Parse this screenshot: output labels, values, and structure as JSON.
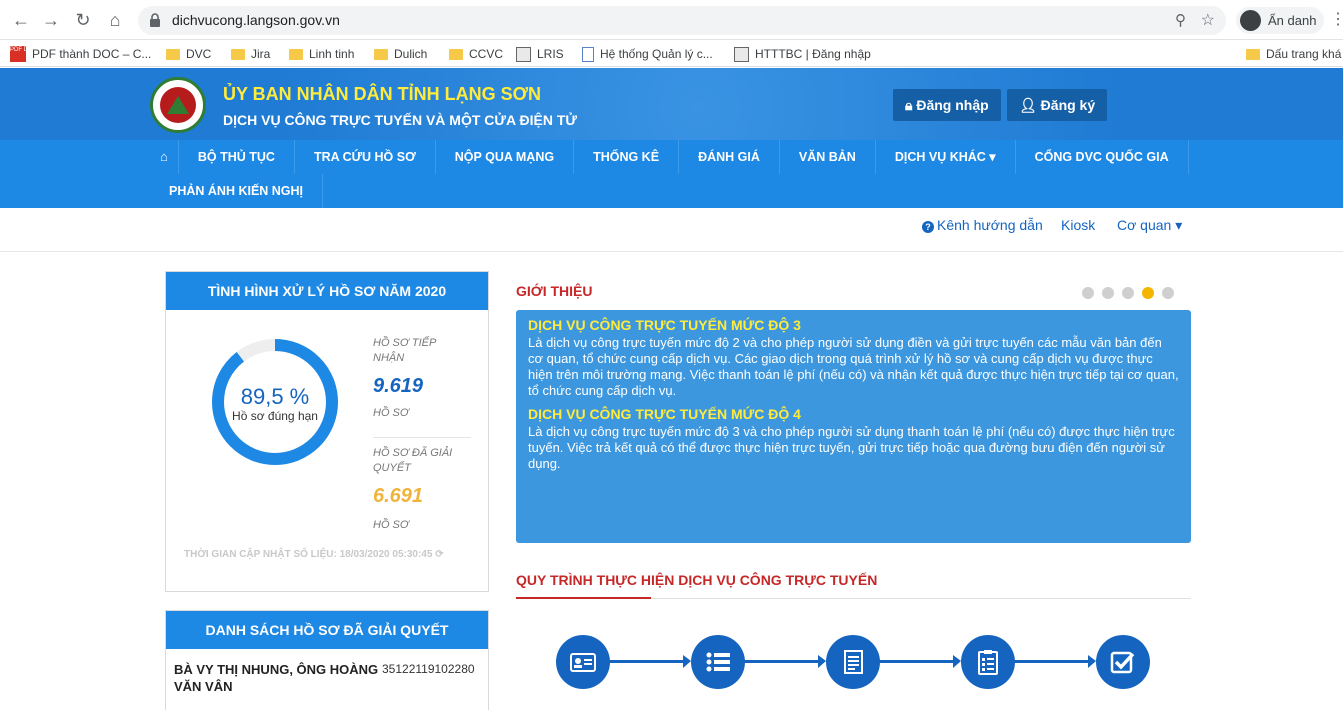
{
  "browser": {
    "url": "dichvucong.langson.gov.vn",
    "profile_label": "Ẩn danh",
    "bookmarks": [
      {
        "label": "PDF thành DOC – C...",
        "icon": "pdf-icon"
      },
      {
        "label": "DVC",
        "icon": "folder-icon"
      },
      {
        "label": "Jira",
        "icon": "folder-icon"
      },
      {
        "label": "Linh tinh",
        "icon": "folder-icon"
      },
      {
        "label": "Dulich",
        "icon": "folder-icon"
      },
      {
        "label": "CCVC",
        "icon": "folder-icon"
      },
      {
        "label": "LRIS",
        "icon": "image-icon"
      },
      {
        "label": "Hệ thống Quản lý c...",
        "icon": "document-icon"
      },
      {
        "label": "HTTTBC | Đăng nhập",
        "icon": "image-icon"
      },
      {
        "label": "Dấu trang khá",
        "icon": "folder-icon"
      }
    ]
  },
  "header": {
    "title": "ỦY BAN NHÂN DÂN TỈNH LẠNG SƠN",
    "subtitle": "DỊCH VỤ CÔNG TRỰC TUYẾN VÀ MỘT CỬA ĐIỆN TỬ",
    "login": "Đăng nhập",
    "register": "Đăng ký"
  },
  "nav": {
    "items": [
      "BỘ THỦ TỤC",
      "TRA CỨU HỒ SƠ",
      "NỘP QUA MẠNG",
      "THỐNG KÊ",
      "ĐÁNH GIÁ",
      "VĂN BẢN",
      "DỊCH VỤ KHÁC",
      "CỔNG DVC QUỐC GIA"
    ],
    "row2": [
      "PHẢN ÁNH KIẾN NGHỊ"
    ]
  },
  "subnav": {
    "guide": "Kênh hướng dẫn",
    "kiosk": "Kiosk",
    "agency": "Cơ quan"
  },
  "stats": {
    "title": "TÌNH HÌNH XỬ LÝ HỒ SƠ NĂM 2020",
    "percent_label": "89,5 %",
    "percent_value": 0.895,
    "percent_caption": "Hồ sơ đúng hạn",
    "received_label": "HỒ SƠ TIẾP NHẬN",
    "received_value": "9.619",
    "received_unit": "HỒ SƠ",
    "solved_label": "HỒ SƠ ĐÃ GIẢI QUYẾT",
    "solved_value": "6.691",
    "solved_unit": "HỒ SƠ",
    "updated": "THỜI GIAN CẬP NHẬT SỐ LIỆU: 18/03/2020 05:30:45",
    "colors": {
      "ring": "#1e88e5",
      "track": "#eeeeee",
      "received": "#1565c0",
      "solved": "#f0b43c"
    }
  },
  "resolved_list": {
    "title": "DANH SÁCH HỒ SƠ ĐÃ GIẢI QUYẾT",
    "rows": [
      {
        "name": "BÀ VY THỊ NHUNG, ÔNG HOÀNG VĂN VÂN",
        "code": "35122119102280"
      }
    ]
  },
  "intro": {
    "title": "GIỚI THIỆU",
    "slides_total": 5,
    "active_slide": 4,
    "sections": [
      {
        "heading": "DỊCH VỤ CÔNG TRỰC TUYẾN MỨC ĐỘ 3",
        "text": "Là dịch vụ công trực tuyến mức độ 2 và cho phép người sử dụng điền và gửi trực tuyến các mẫu văn bản đến cơ quan, tổ chức cung cấp dịch vụ. Các giao dịch trong quá trình xử lý hồ sơ và cung cấp dịch vụ được thực hiện trên môi trường mạng. Việc thanh toán lệ phí (nếu có) và nhận kết quả được thực hiện trực tiếp tại cơ quan, tổ chức cung cấp dịch vụ."
      },
      {
        "heading": "DỊCH VỤ CÔNG TRỰC TUYẾN MỨC ĐỘ 4",
        "text": "Là dịch vụ công trực tuyến mức độ 3 và cho phép người sử dụng thanh toán lệ phí (nếu có) được thực hiện trực tuyến. Việc trả kết quả có thể được thực hiện trực tuyến, gửi trực tiếp hoặc qua đường bưu điện đến người sử dụng."
      }
    ]
  },
  "process": {
    "title": "QUY TRÌNH THỰC HIỆN DỊCH VỤ CÔNG TRỰC TUYẾN",
    "steps": [
      "id-card-icon",
      "list-icon",
      "form-icon",
      "checklist-icon",
      "checkbox-icon"
    ]
  }
}
